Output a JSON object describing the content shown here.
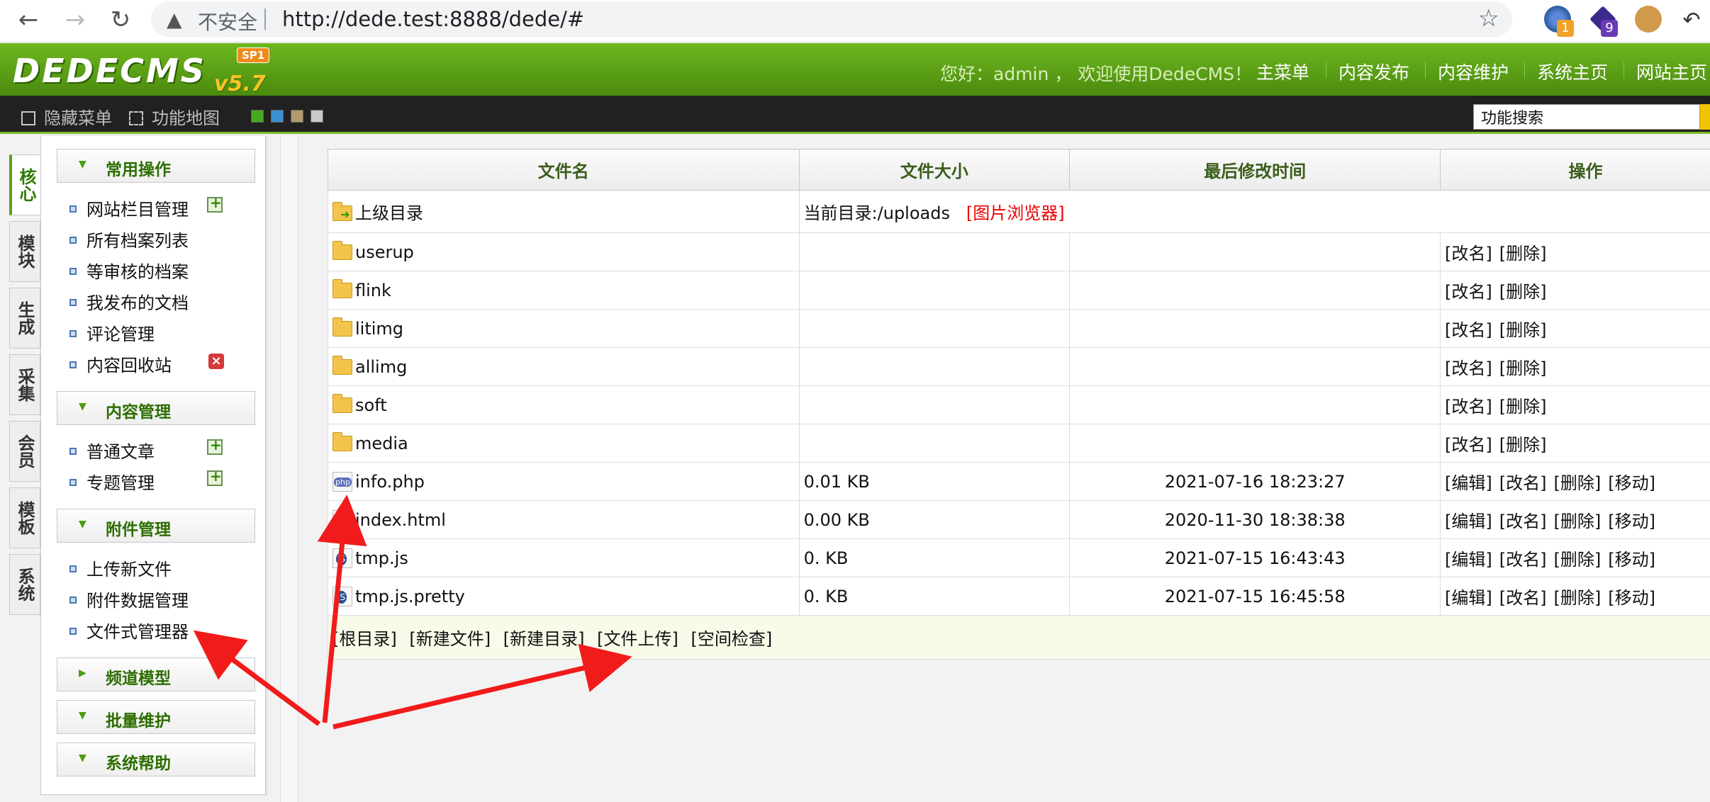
{
  "browser": {
    "security_label": "不安全",
    "url": "http://dede.test:8888/dede/#",
    "extensions": [
      {
        "icon": "extension-a-icon",
        "badge": "1",
        "badge_color": "#f2a12a"
      },
      {
        "icon": "extension-b-icon",
        "badge": "9",
        "badge_color": "#6a3ab8"
      },
      {
        "icon": "cookie-icon",
        "badge": ""
      }
    ]
  },
  "header": {
    "logo_text": "DEDECMS",
    "logo_version": "v5.7",
    "logo_sp": "SP1",
    "welcome": "您好：admin ， 欢迎使用DedeCMS！",
    "nav": [
      "主菜单",
      "内容发布",
      "内容维护",
      "系统主页",
      "网站主页"
    ]
  },
  "toolbar": {
    "hide_menu": "隐藏菜单",
    "func_map": "功能地图",
    "skins": [
      "#48a81e",
      "#3a8fd0",
      "#b39a6e",
      "#c9c9c9"
    ],
    "search_value": "功能搜索"
  },
  "side_tabs": [
    {
      "label": "核心",
      "active": true
    },
    {
      "label": "模块"
    },
    {
      "label": "生成"
    },
    {
      "label": "采集"
    },
    {
      "label": "会员"
    },
    {
      "label": "模板"
    },
    {
      "label": "系统"
    }
  ],
  "menu": {
    "sections": [
      {
        "title": "常用操作",
        "expanded": true,
        "items": [
          "网站栏目管理",
          "所有档案列表",
          "等审核的档案",
          "我发布的文档",
          "评论管理",
          "内容回收站"
        ]
      },
      {
        "title": "内容管理",
        "expanded": true,
        "items": [
          "普通文章",
          "专题管理"
        ]
      },
      {
        "title": "附件管理",
        "expanded": true,
        "items": [
          "上传新文件",
          "附件数据管理",
          "文件式管理器"
        ]
      },
      {
        "title": "频道模型",
        "expanded": false,
        "items": []
      },
      {
        "title": "批量维护",
        "expanded": true,
        "items": []
      },
      {
        "title": "系统帮助",
        "expanded": true,
        "items": []
      }
    ]
  },
  "file_table": {
    "columns": [
      "文件名",
      "文件大小",
      "最后修改时间",
      "操作"
    ],
    "parent_row": {
      "name": "上级目录",
      "current_dir": "当前目录:/uploads",
      "browser_link": "[图片浏览器]"
    },
    "rows": [
      {
        "name": "userup",
        "type": "folder",
        "size": "",
        "time": "",
        "actions": [
          "[改名]",
          "[删除]"
        ]
      },
      {
        "name": "flink",
        "type": "folder",
        "size": "",
        "time": "",
        "actions": [
          "[改名]",
          "[删除]"
        ]
      },
      {
        "name": "litimg",
        "type": "folder",
        "size": "",
        "time": "",
        "actions": [
          "[改名]",
          "[删除]"
        ]
      },
      {
        "name": "allimg",
        "type": "folder",
        "size": "",
        "time": "",
        "actions": [
          "[改名]",
          "[删除]"
        ]
      },
      {
        "name": "soft",
        "type": "folder",
        "size": "",
        "time": "",
        "actions": [
          "[改名]",
          "[删除]"
        ]
      },
      {
        "name": "media",
        "type": "folder",
        "size": "",
        "time": "",
        "actions": [
          "[改名]",
          "[删除]"
        ]
      },
      {
        "name": "info.php",
        "type": "php",
        "size": "0.01 KB",
        "time": "2021-07-16 18:23:27",
        "actions": [
          "[编辑]",
          "[改名]",
          "[删除]",
          "[移动]"
        ]
      },
      {
        "name": "index.html",
        "type": "html",
        "size": "0.00 KB",
        "time": "2020-11-30 18:38:38",
        "actions": [
          "[编辑]",
          "[改名]",
          "[删除]",
          "[移动]"
        ]
      },
      {
        "name": "tmp.js",
        "type": "js",
        "size": "0. KB",
        "time": "2021-07-15 16:43:43",
        "actions": [
          "[编辑]",
          "[改名]",
          "[删除]",
          "[移动]"
        ]
      },
      {
        "name": "tmp.js.pretty",
        "type": "js",
        "size": "0. KB",
        "time": "2021-07-15 16:45:58",
        "actions": [
          "[编辑]",
          "[改名]",
          "[删除]",
          "[移动]"
        ]
      }
    ],
    "footer_links": [
      "[根目录]",
      "[新建文件]",
      "[新建目录]",
      "[文件上传]",
      "[空间检查]"
    ]
  }
}
